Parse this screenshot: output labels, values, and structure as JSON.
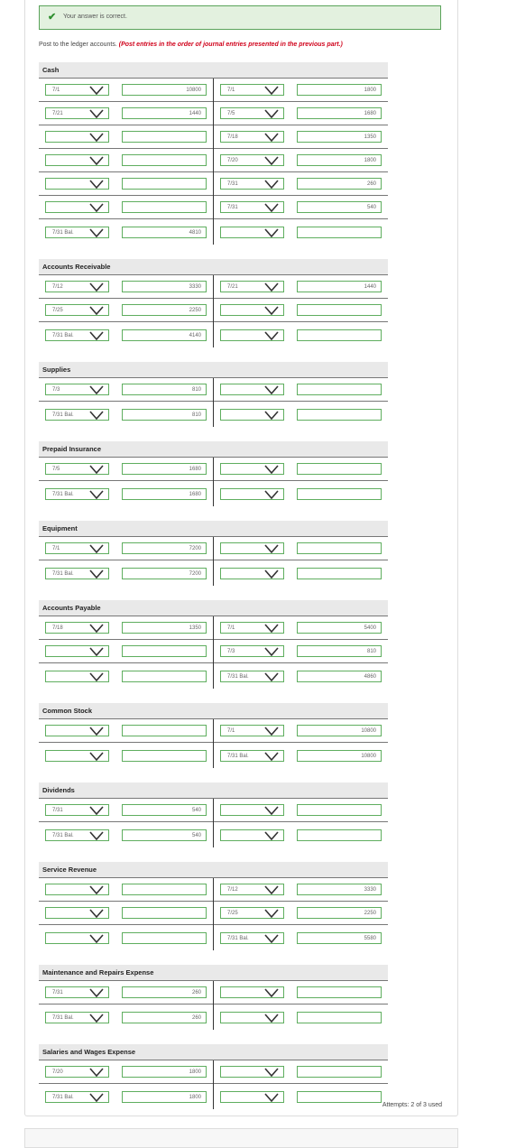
{
  "banner": {
    "message": "Your answer is correct."
  },
  "instructions": {
    "text": "Post to the ledger accounts.",
    "note": "(Post entries in the order of journal entries presented in the previous part.)"
  },
  "accounts": [
    {
      "name": "Cash",
      "rows": [
        {
          "ld": "7/1",
          "lv": "10800",
          "rd": "7/1",
          "rv": "1800"
        },
        {
          "ld": "7/21",
          "lv": "1440",
          "rd": "7/5",
          "rv": "1680"
        },
        {
          "ld": "",
          "lv": "",
          "rd": "7/18",
          "rv": "1350"
        },
        {
          "ld": "",
          "lv": "",
          "rd": "7/20",
          "rv": "1800"
        },
        {
          "ld": "",
          "lv": "",
          "rd": "7/31",
          "rv": "260"
        },
        {
          "ld": "",
          "lv": "",
          "rd": "7/31",
          "rv": "540"
        },
        {
          "ld": "7/31 Bal.",
          "lv": "4810",
          "rd": "",
          "rv": ""
        }
      ]
    },
    {
      "name": "Accounts Receivable",
      "rows": [
        {
          "ld": "7/12",
          "lv": "3330",
          "rd": "7/21",
          "rv": "1440"
        },
        {
          "ld": "7/25",
          "lv": "2250",
          "rd": "",
          "rv": ""
        },
        {
          "ld": "7/31 Bal.",
          "lv": "4140",
          "rd": "",
          "rv": ""
        }
      ]
    },
    {
      "name": "Supplies",
      "rows": [
        {
          "ld": "7/3",
          "lv": "810",
          "rd": "",
          "rv": ""
        },
        {
          "ld": "7/31 Bal.",
          "lv": "810",
          "rd": "",
          "rv": ""
        }
      ]
    },
    {
      "name": "Prepaid Insurance",
      "rows": [
        {
          "ld": "7/5",
          "lv": "1680",
          "rd": "",
          "rv": ""
        },
        {
          "ld": "7/31 Bal.",
          "lv": "1680",
          "rd": "",
          "rv": ""
        }
      ]
    },
    {
      "name": "Equipment",
      "rows": [
        {
          "ld": "7/1",
          "lv": "7200",
          "rd": "",
          "rv": ""
        },
        {
          "ld": "7/31 Bal.",
          "lv": "7200",
          "rd": "",
          "rv": ""
        }
      ]
    },
    {
      "name": "Accounts Payable",
      "rows": [
        {
          "ld": "7/18",
          "lv": "1350",
          "rd": "7/1",
          "rv": "5400"
        },
        {
          "ld": "",
          "lv": "",
          "rd": "7/3",
          "rv": "810"
        },
        {
          "ld": "",
          "lv": "",
          "rd": "7/31 Bal.",
          "rv": "4860"
        }
      ]
    },
    {
      "name": "Common Stock",
      "rows": [
        {
          "ld": "",
          "lv": "",
          "rd": "7/1",
          "rv": "10800"
        },
        {
          "ld": "",
          "lv": "",
          "rd": "7/31 Bal.",
          "rv": "10800"
        }
      ]
    },
    {
      "name": "Dividends",
      "rows": [
        {
          "ld": "7/31",
          "lv": "540",
          "rd": "",
          "rv": ""
        },
        {
          "ld": "7/31 Bal.",
          "lv": "540",
          "rd": "",
          "rv": ""
        }
      ]
    },
    {
      "name": "Service Revenue",
      "rows": [
        {
          "ld": "",
          "lv": "",
          "rd": "7/12",
          "rv": "3330"
        },
        {
          "ld": "",
          "lv": "",
          "rd": "7/25",
          "rv": "2250"
        },
        {
          "ld": "",
          "lv": "",
          "rd": "7/31 Bal.",
          "rv": "5580"
        }
      ]
    },
    {
      "name": "Maintenance and Repairs Expense",
      "rows": [
        {
          "ld": "7/31",
          "lv": "260",
          "rd": "",
          "rv": ""
        },
        {
          "ld": "7/31 Bal.",
          "lv": "260",
          "rd": "",
          "rv": ""
        }
      ]
    },
    {
      "name": "Salaries and Wages Expense",
      "rows": [
        {
          "ld": "7/20",
          "lv": "1800",
          "rd": "",
          "rv": ""
        },
        {
          "ld": "7/31 Bal.",
          "lv": "1800",
          "rd": "",
          "rv": ""
        }
      ]
    }
  ],
  "footer": {
    "attempts": "Attempts: 2 of 3 used"
  },
  "colors": {
    "success_bg": "#e3f1df",
    "success_border": "#5aa35a",
    "field_border": "#5fae5f",
    "note_red": "#d0021b"
  },
  "icons": {
    "banner": "check-icon",
    "dropdown": "chevron-down-icon"
  }
}
